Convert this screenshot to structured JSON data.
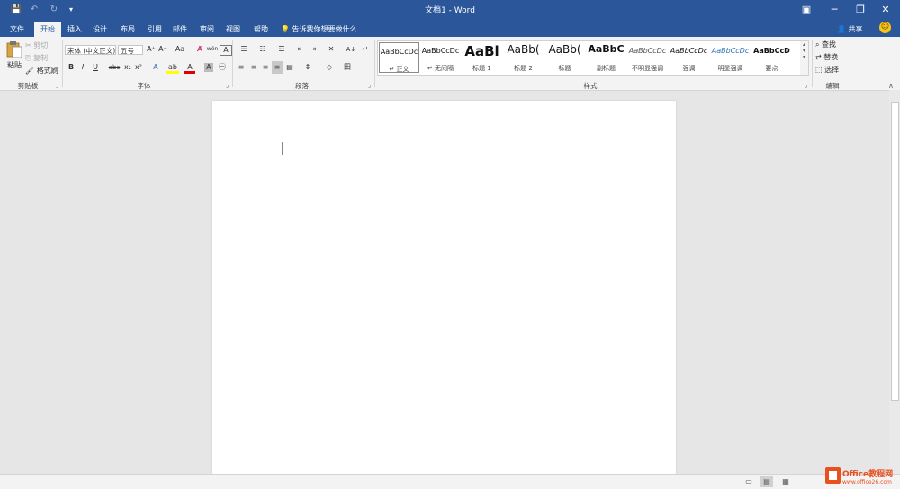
{
  "colors": {
    "brand": "#2b579a",
    "ribbon": "#f3f3f3",
    "canvas": "#e6e6e6",
    "font_color_red": "#e00000",
    "highlight_yellow": "#ffff00"
  },
  "title_bar": {
    "document_title": "文档1 - Word",
    "qat": {
      "save_icon": "💾",
      "undo_icon": "↶",
      "redo_icon": "↻",
      "customize_icon": "▾"
    },
    "window": {
      "ribbon_options_icon": "▣",
      "minimize_icon": "─",
      "restore_icon": "❐",
      "close_icon": "✕"
    }
  },
  "tabs": [
    {
      "label": "文件"
    },
    {
      "label": "开始"
    },
    {
      "label": "插入"
    },
    {
      "label": "设计"
    },
    {
      "label": "布局"
    },
    {
      "label": "引用"
    },
    {
      "label": "邮件"
    },
    {
      "label": "审阅"
    },
    {
      "label": "视图"
    },
    {
      "label": "帮助"
    }
  ],
  "active_tab": "开始",
  "tell_me": {
    "icon": "💡",
    "text": "告诉我你想要做什么"
  },
  "share": {
    "icon": "👤",
    "label": "共享"
  },
  "smiley_icon": "☺",
  "ribbon": {
    "clipboard": {
      "group_label": "剪贴板",
      "paste_label": "粘贴",
      "cut_label": "剪切",
      "copy_label": "复制",
      "format_painter_label": "格式刷",
      "cut_icon": "✂",
      "copy_icon": "⎘",
      "painter_icon": "🖌"
    },
    "font": {
      "group_label": "字体",
      "font_name": "宋体 (中文正文)",
      "font_size": "五号",
      "grow_icon": "A⁺",
      "shrink_icon": "A⁻",
      "change_case_icon": "Aa",
      "clear_format_icon": "A̸",
      "phonetic_icon": "wén",
      "border_char_icon": "A",
      "bold": "B",
      "italic": "I",
      "underline": "U",
      "strikethrough": "abc",
      "subscript": "x₂",
      "superscript": "x²",
      "text_effects_icon": "A",
      "highlight_icon": "ab",
      "font_color_icon": "A",
      "shading_icon": "A",
      "enclose_icon": "㊀"
    },
    "paragraph": {
      "group_label": "段落",
      "bullets_icon": "☰",
      "numbering_icon": "☷",
      "multilevel_icon": "☲",
      "decrease_indent_icon": "⇤",
      "increase_indent_icon": "⇥",
      "chinese_layout_icon": "✕",
      "sort_icon": "A↓",
      "show_marks_icon": "↵",
      "align_left_icon": "≡",
      "center_icon": "≡",
      "align_right_icon": "≡",
      "justify_icon": "≡",
      "distributed_icon": "▤",
      "line_spacing_icon": "↕",
      "shading_icon": "◇",
      "borders_icon": "田"
    },
    "styles": {
      "group_label": "样式",
      "items": [
        {
          "sample": "AaBbCcDc",
          "name": "↵ 正文",
          "sample_size": "8px",
          "bold": false,
          "italic": false,
          "color": "#111"
        },
        {
          "sample": "AaBbCcDc",
          "name": "↵ 无间隔",
          "sample_size": "8px",
          "bold": false,
          "italic": false,
          "color": "#111"
        },
        {
          "sample": "AaBl",
          "name": "标题 1",
          "sample_size": "15px",
          "bold": true,
          "italic": false,
          "color": "#111"
        },
        {
          "sample": "AaBb(",
          "name": "标题 2",
          "sample_size": "12px",
          "bold": false,
          "italic": false,
          "color": "#111"
        },
        {
          "sample": "AaBb(",
          "name": "标题",
          "sample_size": "12px",
          "bold": false,
          "italic": false,
          "color": "#111"
        },
        {
          "sample": "AaBbC",
          "name": "副标题",
          "sample_size": "11px",
          "bold": true,
          "italic": false,
          "color": "#111"
        },
        {
          "sample": "AaBbCcDc",
          "name": "不明显强调",
          "sample_size": "8px",
          "bold": false,
          "italic": true,
          "color": "#555"
        },
        {
          "sample": "AaBbCcDc",
          "name": "强调",
          "sample_size": "8px",
          "bold": false,
          "italic": true,
          "color": "#111"
        },
        {
          "sample": "AaBbCcDc",
          "name": "明显强调",
          "sample_size": "8px",
          "bold": false,
          "italic": true,
          "color": "#2e74b5"
        },
        {
          "sample": "AaBbCcD",
          "name": "要点",
          "sample_size": "8px",
          "bold": true,
          "italic": false,
          "color": "#111"
        }
      ]
    },
    "editing": {
      "group_label": "编辑",
      "find_label": "查找",
      "replace_label": "替换",
      "select_label": "选择",
      "find_icon": "⌕",
      "replace_icon": "⇄",
      "select_icon": "⬚"
    },
    "launcher_icon": "⌟",
    "collapse_icon": "∧"
  },
  "status_bar": {
    "read_mode_icon": "▭",
    "print_layout_icon": "▤",
    "web_layout_icon": "▦",
    "zoom_out_icon": "−",
    "zoom_in_icon": "+"
  },
  "watermark": {
    "text_main": "Office教程网",
    "text_sub": "www.office26.com"
  }
}
